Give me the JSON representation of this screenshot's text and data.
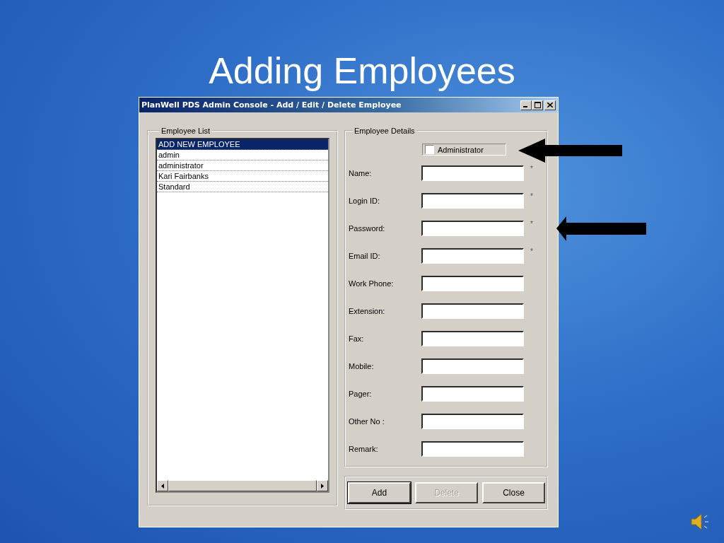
{
  "slide": {
    "title": "Adding Employees"
  },
  "window": {
    "title": "PlanWell PDS Admin Console - Add / Edit / Delete Employee"
  },
  "employee_list": {
    "label": "Employee List",
    "items": [
      {
        "text": "ADD NEW EMPLOYEE",
        "selected": true
      },
      {
        "text": "admin",
        "selected": false
      },
      {
        "text": "administrator",
        "selected": false
      },
      {
        "text": "Kari Fairbanks",
        "selected": false
      },
      {
        "text": "Standard",
        "selected": false
      }
    ]
  },
  "employee_details": {
    "label": "Employee Details",
    "administrator": {
      "label": "Administrator",
      "checked": false
    },
    "fields": [
      {
        "label": "Name:",
        "required_mark": "*"
      },
      {
        "label": "Login ID:",
        "required_mark": "*"
      },
      {
        "label": "Password:",
        "required_mark": "*"
      },
      {
        "label": "Email ID:",
        "required_mark": "*"
      },
      {
        "label": "Work Phone:"
      },
      {
        "label": "Extension:"
      },
      {
        "label": "Fax:"
      },
      {
        "label": "Mobile:"
      },
      {
        "label": "Pager:"
      },
      {
        "label": "Other No :"
      },
      {
        "label": "Remark:"
      }
    ]
  },
  "buttons": [
    {
      "label": "Add",
      "disabled": false,
      "default": true
    },
    {
      "label": "Delete",
      "disabled": true,
      "default": false
    },
    {
      "label": "Close",
      "disabled": false,
      "default": false
    }
  ]
}
